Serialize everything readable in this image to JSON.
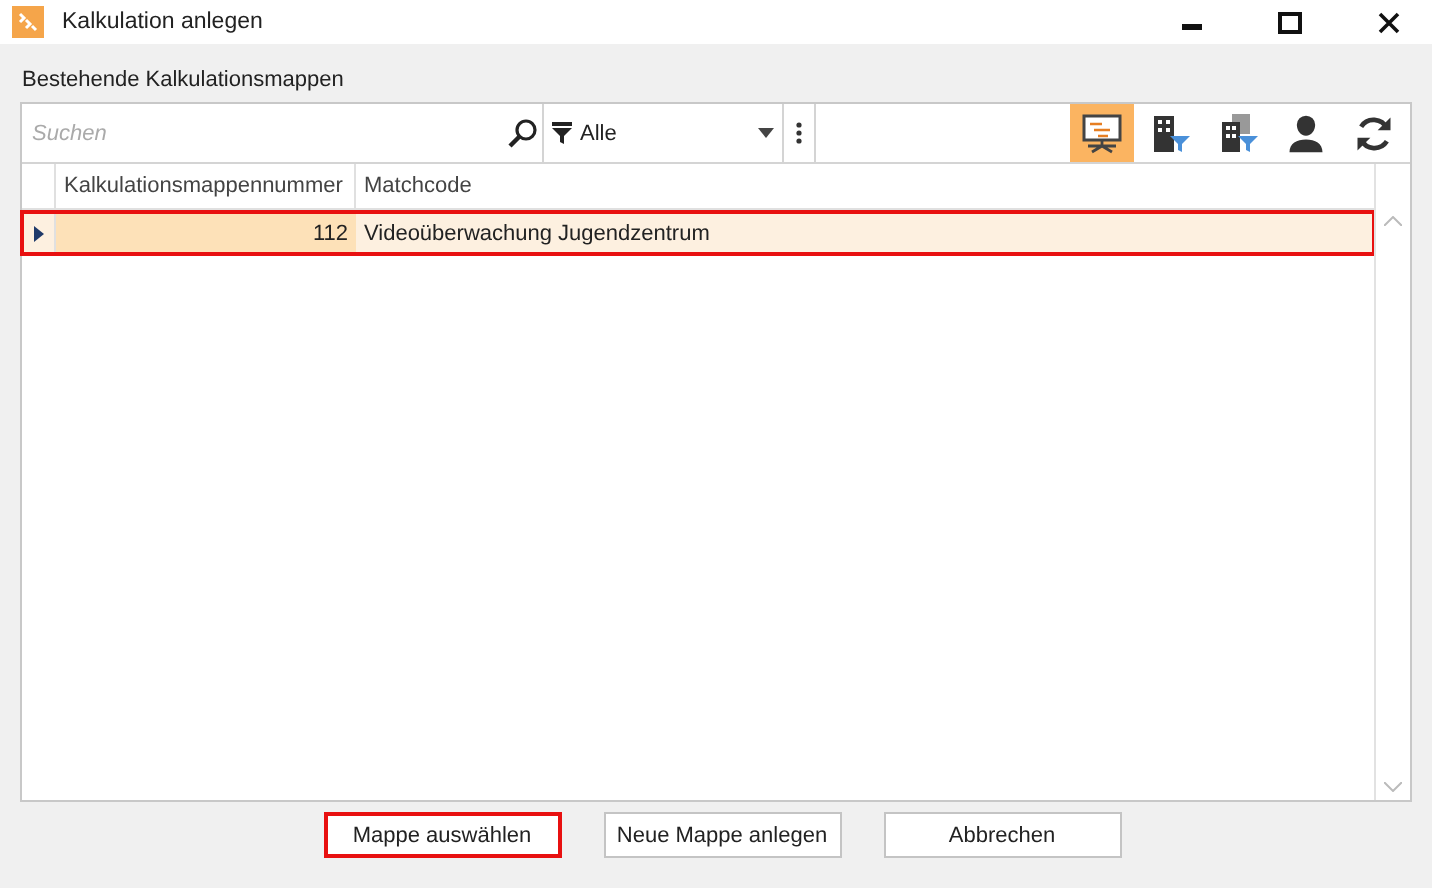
{
  "window": {
    "title": "Kalkulation anlegen"
  },
  "section_label": "Bestehende Kalkulationsmappen",
  "search": {
    "placeholder": "Suchen"
  },
  "filter": {
    "value": "Alle"
  },
  "toolbar_buttons": [
    {
      "kind": "presentation",
      "selected": true
    },
    {
      "kind": "building-filter",
      "selected": false
    },
    {
      "kind": "buildings-filter",
      "selected": false
    },
    {
      "kind": "person",
      "selected": false
    },
    {
      "kind": "refresh",
      "selected": false
    }
  ],
  "table": {
    "columns": [
      "Kalkulationsmappennummer",
      "Matchcode"
    ],
    "rows": [
      {
        "number": "112",
        "matchcode": "Videoüberwachung Jugendzentrum",
        "selected": true
      }
    ]
  },
  "buttons": [
    {
      "label": "Mappe auswählen",
      "focused": true
    },
    {
      "label": "Neue Mappe anlegen",
      "focused": false
    },
    {
      "label": "Abbrechen",
      "focused": false
    }
  ]
}
